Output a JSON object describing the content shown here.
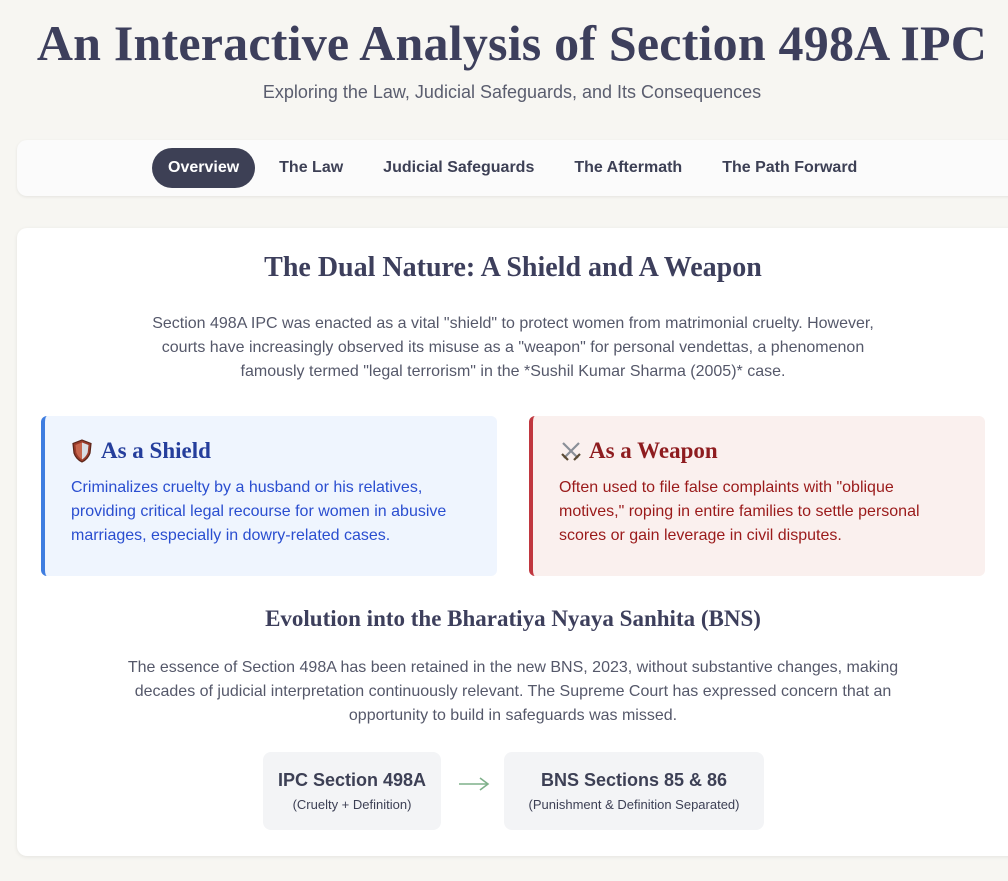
{
  "header": {
    "title": "An Interactive Analysis of Section 498A IPC",
    "subtitle": "Exploring the Law, Judicial Safeguards, and Its Consequences"
  },
  "nav": {
    "tabs": [
      {
        "label": "Overview",
        "active": true
      },
      {
        "label": "The Law",
        "active": false
      },
      {
        "label": "Judicial Safeguards",
        "active": false
      },
      {
        "label": "The Aftermath",
        "active": false
      },
      {
        "label": "The Path Forward",
        "active": false
      }
    ]
  },
  "dual_nature": {
    "title": "The Dual Nature: A Shield and A Weapon",
    "intro": "Section 498A IPC was enacted as a vital \"shield\" to protect women from matrimonial cruelty. However, courts have increasingly observed its misuse as a \"weapon\" for personal vendettas, a phenomenon famously termed \"legal terrorism\" in the *Sushil Kumar Sharma (2005)* case.",
    "shield": {
      "icon": "shield-icon",
      "heading": "As a Shield",
      "body": "Criminalizes cruelty by a husband or his relatives, providing critical legal recourse for women in abusive marriages, especially in dowry-related cases.",
      "accent": "#3e7de0"
    },
    "weapon": {
      "icon": "crossed-swords-icon",
      "heading": "As a Weapon",
      "body": "Often used to file false complaints with \"oblique motives,\" roping in entire families to settle personal scores or gain leverage in civil disputes.",
      "accent": "#c0373f"
    }
  },
  "evolution": {
    "title": "Evolution into the Bharatiya Nyaya Sanhita (BNS)",
    "body": "The essence of Section 498A has been retained in the new BNS, 2023, without substantive changes, making decades of judicial interpretation continuously relevant. The Supreme Court has expressed concern that an opportunity to build in safeguards was missed.",
    "from": {
      "name": "IPC Section 498A",
      "desc": "(Cruelty + Definition)"
    },
    "to": {
      "name": "BNS Sections 85 & 86",
      "desc": "(Punishment & Definition Separated)"
    },
    "arrow_icon": "right-arrow-icon"
  }
}
